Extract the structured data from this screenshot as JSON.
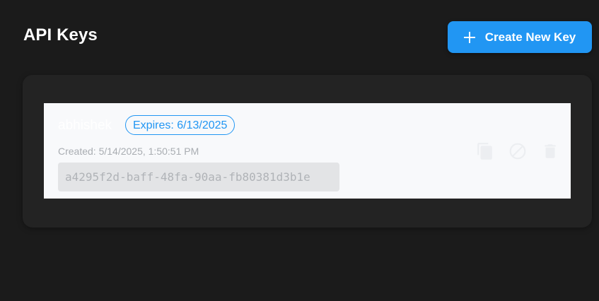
{
  "header": {
    "title": "API Keys",
    "create_button_label": "Create New Key"
  },
  "keys": [
    {
      "name": "abhishek",
      "expires": "Expires: 6/13/2025",
      "created": "Created: 5/14/2025, 1:50:51 PM",
      "value": "a4295f2d-baff-48fa-90aa-fb80381d3b1e",
      "actions": [
        "copy-icon",
        "revoke-icon",
        "delete-icon"
      ]
    }
  ],
  "colors": {
    "background": "#1b1b1b",
    "panel": "#232323",
    "accent": "#2196f3",
    "card": "#f8f9fb"
  }
}
